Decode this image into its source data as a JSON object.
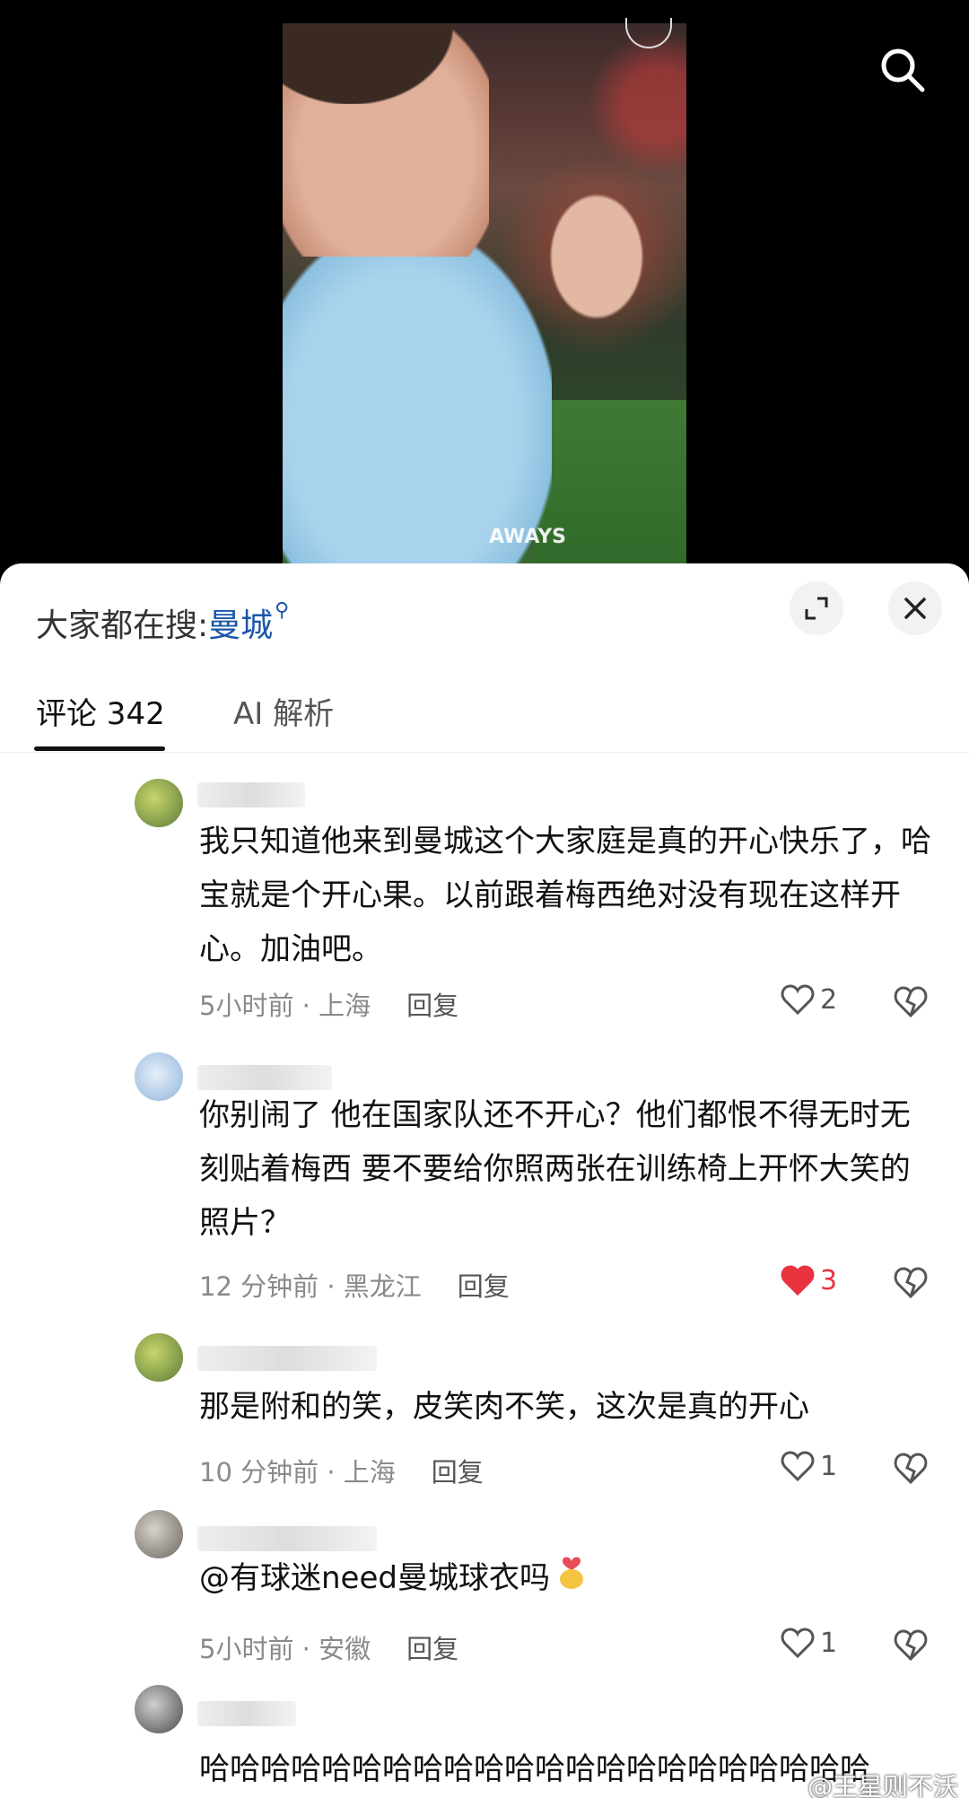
{
  "video": {
    "shirt_text": "AWAYS"
  },
  "sheet": {
    "trending_label": "大家都在搜:",
    "trending_keyword": "曼城",
    "tabs": {
      "comments": "评论 342",
      "ai": "AI 解析"
    }
  },
  "comments": [
    {
      "text": "我只知道他来到曼城这个大家庭是真的开心快乐了，哈宝就是个开心果。以前跟着梅西绝对没有现在这样开心。加油吧。",
      "meta": "5小时前 · 上海",
      "reply": "回复",
      "likes": "2",
      "liked": false
    },
    {
      "text": "你别闹了 他在国家队还不开心？他们都恨不得无时无刻贴着梅西 要不要给你照两张在训练椅上开怀大笑的照片？",
      "meta": "12 分钟前 · 黑龙江",
      "reply": "回复",
      "likes": "3",
      "liked": true
    },
    {
      "text": "那是附和的笑，皮笑肉不笑，这次是真的开心",
      "meta": "10 分钟前 · 上海",
      "reply": "回复",
      "likes": "1",
      "liked": false
    },
    {
      "text": "@有球迷need曼城球衣吗",
      "meta": "5小时前 · 安徽",
      "reply": "回复",
      "likes": "1",
      "liked": false
    },
    {
      "text": "哈哈哈哈哈哈哈哈哈哈哈哈哈哈哈哈哈哈哈哈哈哈"
    }
  ],
  "watermark": "@王星则不沃",
  "colors": {
    "accent_link": "#1a56a8",
    "like_red": "#e8333f"
  }
}
